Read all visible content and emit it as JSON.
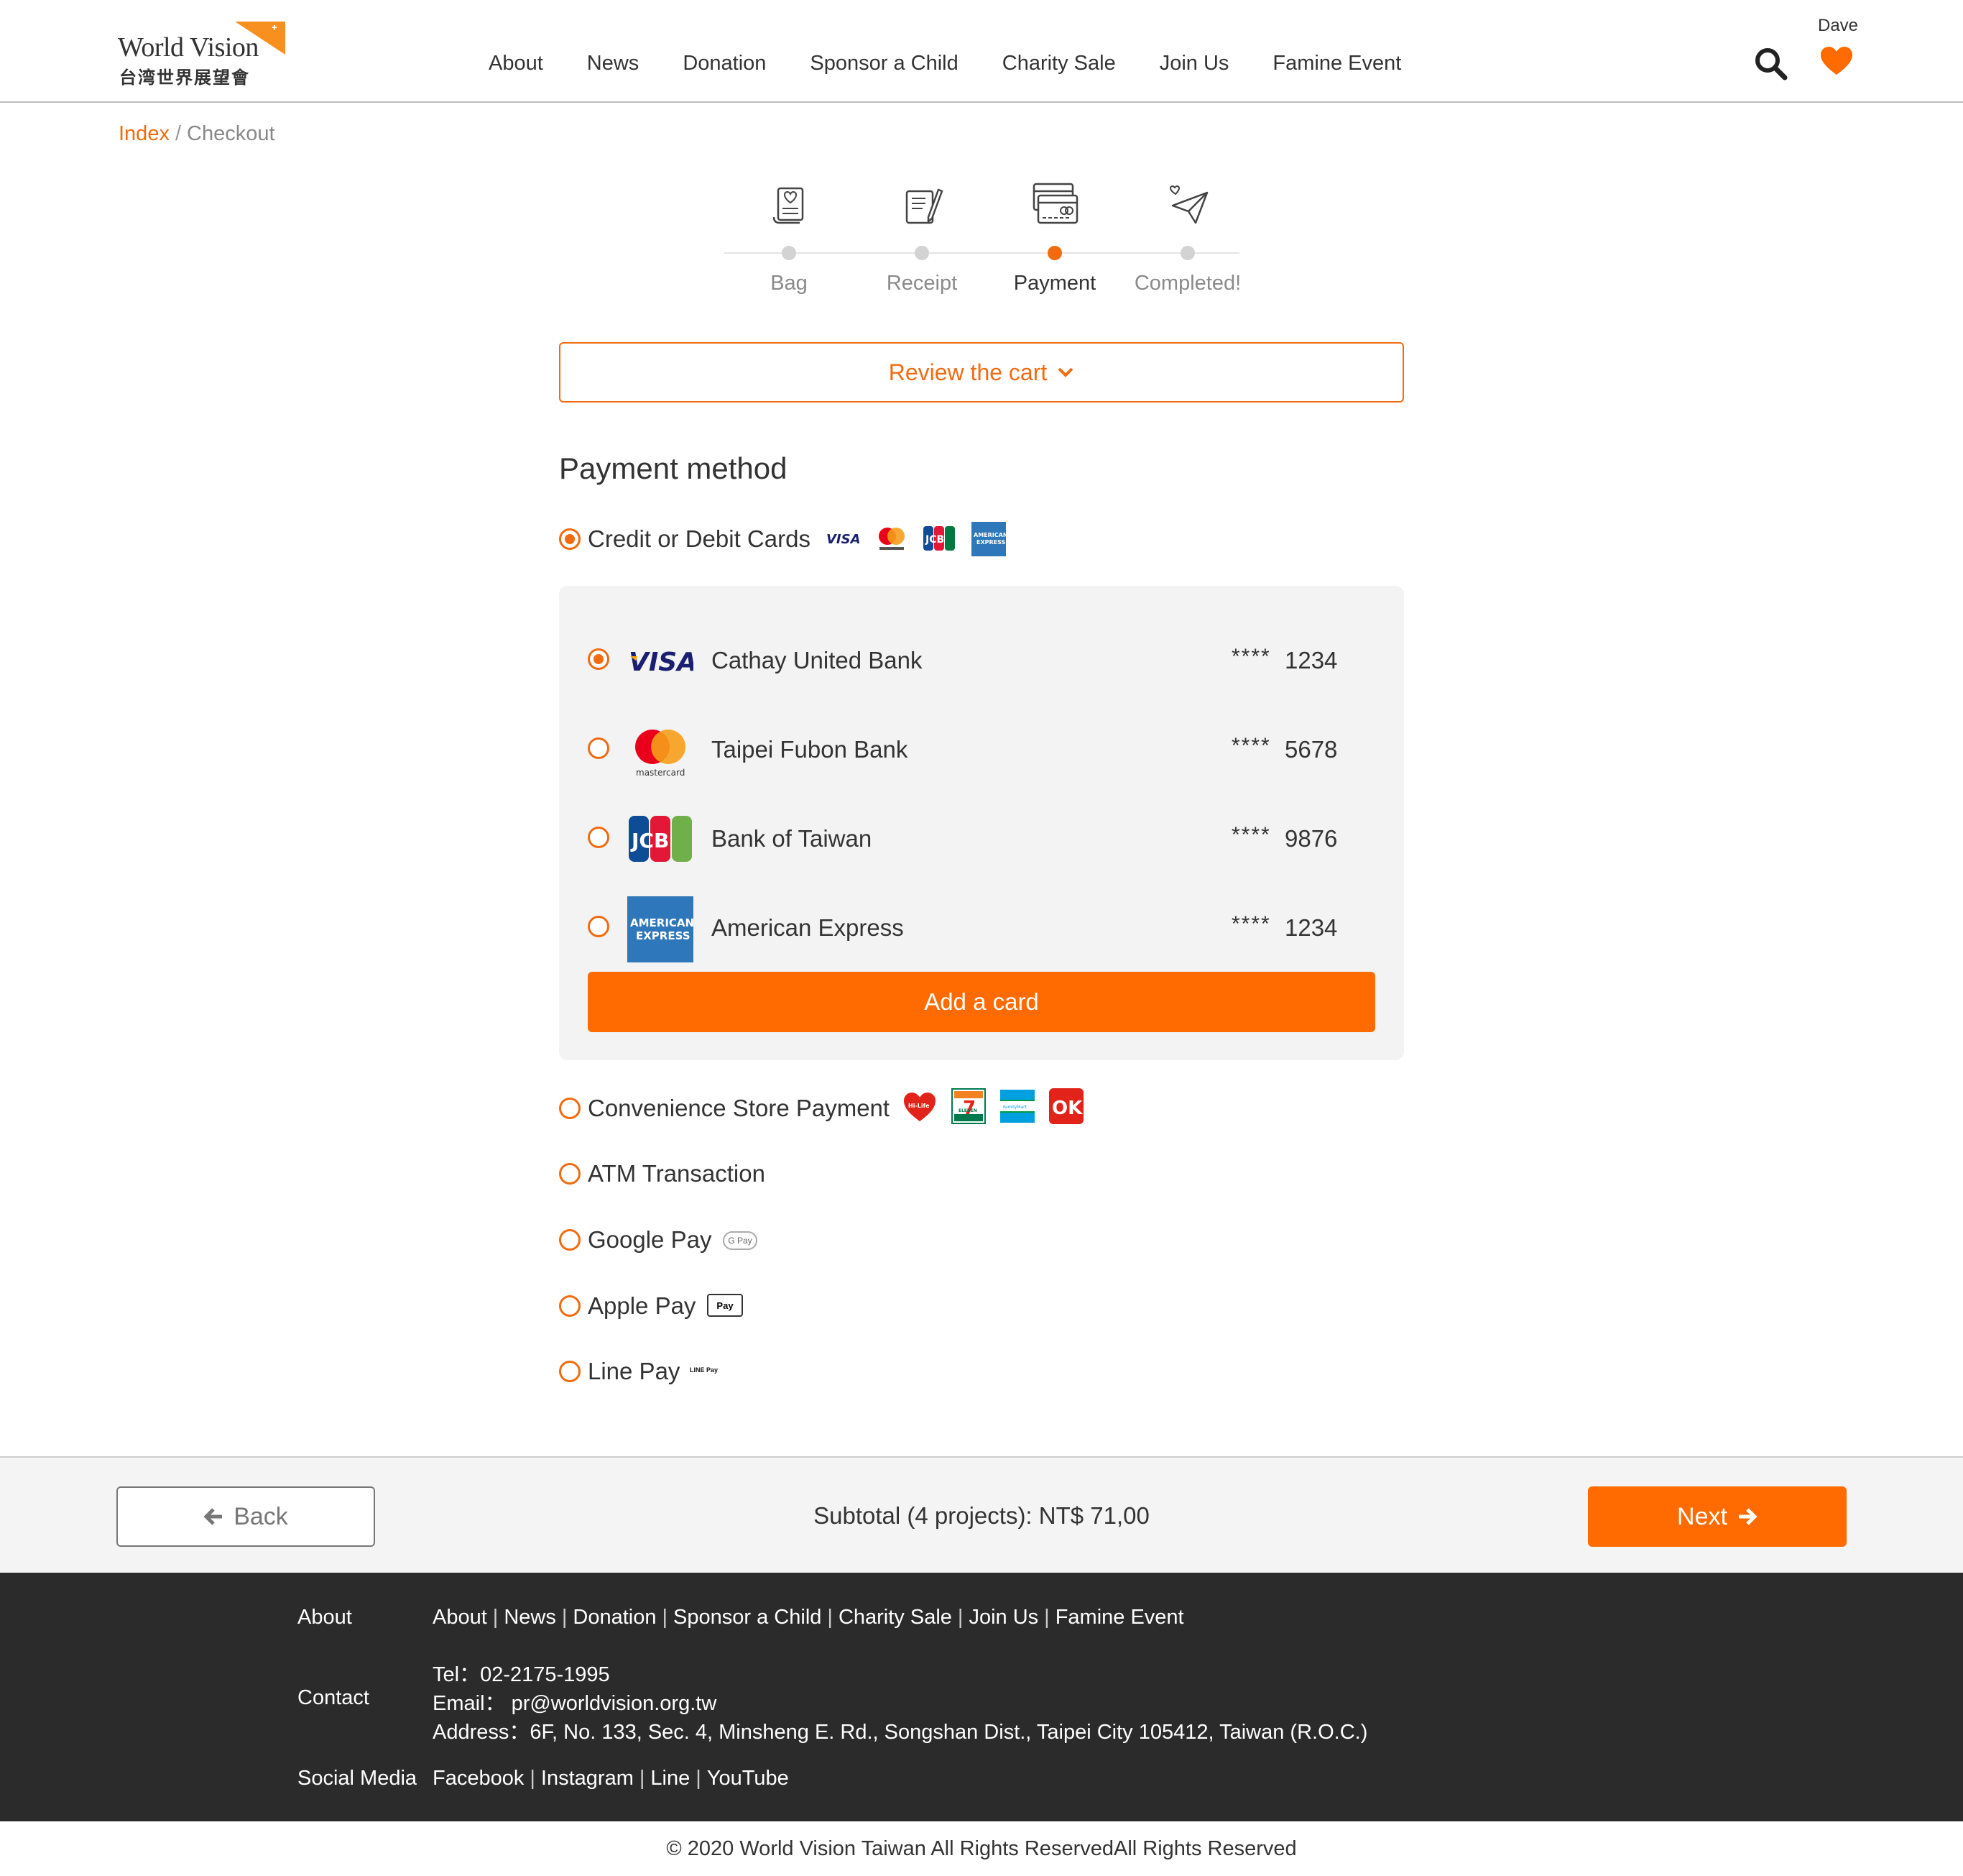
{
  "header": {
    "logo_en": "World Vision",
    "logo_zh": "台湾世界展望會",
    "nav": [
      "About",
      "News",
      "Donation",
      "Sponsor a Child",
      "Charity Sale",
      "Join Us",
      "Famine Event"
    ],
    "user_name": "Dave",
    "icons": [
      "search-icon",
      "heart-icon"
    ]
  },
  "breadcrumb": {
    "home": "Index",
    "sep": "/",
    "current": "Checkout"
  },
  "steps": [
    {
      "label": "Bag",
      "icon": "bag-receipt-icon"
    },
    {
      "label": "Receipt",
      "icon": "receipt-pen-icon"
    },
    {
      "label": "Payment",
      "icon": "credit-card-icon",
      "active": true
    },
    {
      "label": "Completed!",
      "icon": "paper-plane-icon"
    }
  ],
  "review_cart": "Review the cart",
  "payment": {
    "title": "Payment method",
    "credit_label": "Credit or Debit Cards",
    "cards": [
      {
        "brand": "VISA",
        "bank": "Cathay United Bank",
        "mask": "****",
        "last4": "1234",
        "selected": true
      },
      {
        "brand": "mastercard",
        "bank": "Taipei Fubon Bank",
        "mask": "****",
        "last4": "5678",
        "selected": false
      },
      {
        "brand": "JCB",
        "bank": "Bank of Taiwan",
        "mask": "****",
        "last4": "9876",
        "selected": false
      },
      {
        "brand": "AMERICAN EXPRESS",
        "bank": "American Express",
        "mask": "****",
        "last4": "1234",
        "selected": false
      }
    ],
    "add_card": "Add a card",
    "others": [
      {
        "label": "Convenience Store Payment"
      },
      {
        "label": "ATM Transaction"
      },
      {
        "label": "Google Pay",
        "badge": "G Pay"
      },
      {
        "label": "Apple Pay",
        "badge": "Pay"
      },
      {
        "label": "Line Pay",
        "badge": "LINE Pay"
      }
    ],
    "store_logos": {
      "hilife": "Hi-Life",
      "seven": "7",
      "seven_sub": "ELEVEN",
      "family": "FamilyMart",
      "ok": "OK"
    }
  },
  "bottom": {
    "back": "Back",
    "subtotal": "Subtotal (4 projects): NT$ 71,00",
    "next": "Next"
  },
  "footer": {
    "about_label": "About",
    "about_links": [
      "About",
      "News",
      "Donation",
      "Sponsor a Child",
      "Charity Sale",
      "Join Us",
      "Famine Event"
    ],
    "contact_label": "Contact",
    "tel": "Tel：02-2175-1995",
    "email": "Email： pr@worldvision.org.tw",
    "address": "Address：6F, No. 133, Sec. 4, Minsheng E. Rd., Songshan Dist., Taipei City 105412, Taiwan (R.O.C.)",
    "social_label": "Social Media",
    "social_links": [
      "Facebook",
      "Instagram",
      "Line",
      "YouTube"
    ],
    "copyright": "© 2020 World Vision Taiwan All Rights ReservedAll Rights Reserved"
  },
  "colors": {
    "accent": "#ff6b00",
    "accent_dark": "#f26b10",
    "footer_bg": "#2b2b2b",
    "panel_bg": "#f3f3f3"
  }
}
